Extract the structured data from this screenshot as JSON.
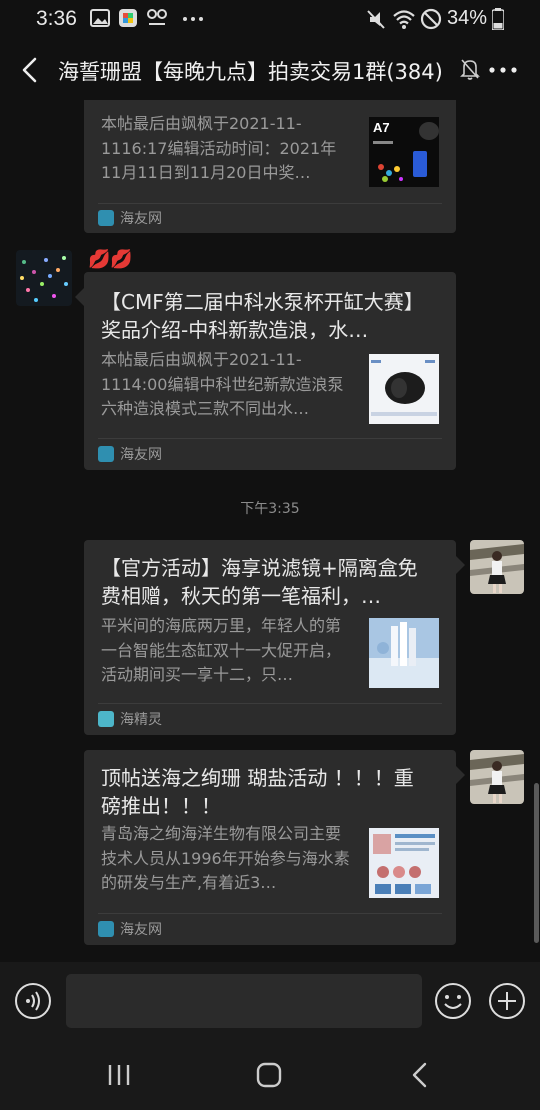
{
  "status_bar": {
    "time": "3:36",
    "battery": "34%"
  },
  "header": {
    "title": "海誓珊盟【每晚九点】拍卖交易1群(384)"
  },
  "messages": [
    {
      "title": "",
      "desc": "本帖最后由飒枫于2021-11-1116:17编辑活动时间：2021年11月11日到11月20日中奖…",
      "source": "海友网",
      "thumb_label": "A7"
    },
    {
      "sender_nickname_emoji": "💋💋",
      "title": "【CMF第二届中科水泵杯开缸大赛】奖品介绍-中科新款造浪，水…",
      "desc": "本帖最后由飒枫于2021-11-1114:00编辑中科世纪新款造浪泵六种造浪模式三款不同出水…",
      "source": "海友网"
    },
    {
      "title": "【官方活动】海享说滤镜+隔离盒免费相赠，秋天的第一笔福利，…",
      "desc": "平米间的海底两万里，年轻人的第一台智能生态缸双十一大促开启，活动期间买一享十二，只…",
      "source": "海精灵"
    },
    {
      "title": "顶帖送海之绚珊 瑚盐活动 ！！！重磅推出！！！",
      "desc": "青岛海之绚海洋生物有限公司主要技术人员从1996年开始参与海水素的研发与生产,有着近3…",
      "source": "海友网"
    }
  ],
  "timestamp": "下午3:35",
  "colors": {
    "background": "#111111",
    "card": "#2c2c2c",
    "text_primary": "#e8e8e8",
    "text_secondary": "#9a9a9a"
  },
  "icons": [
    "back-arrow-icon",
    "mute-bell-icon",
    "more-icon",
    "voice-icon",
    "emoji-icon",
    "plus-icon",
    "recent-apps-icon",
    "home-icon",
    "nav-back-icon"
  ]
}
